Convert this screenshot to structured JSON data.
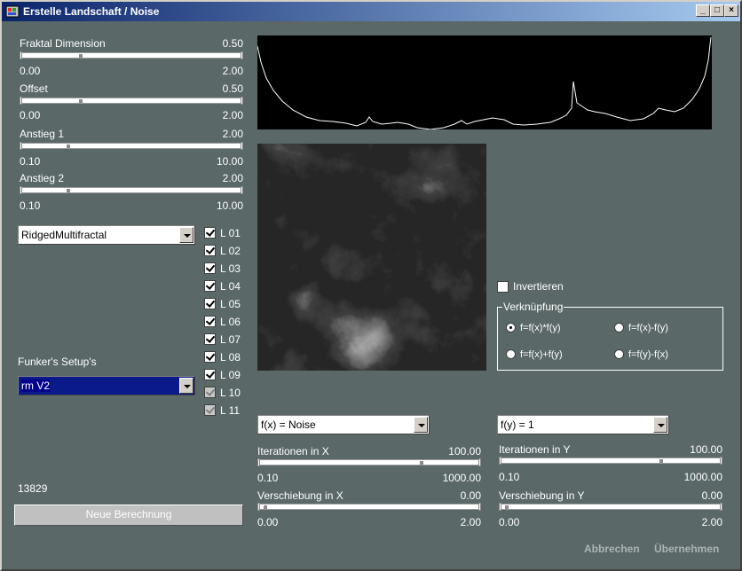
{
  "window": {
    "title": "Erstelle Landschaft / Noise"
  },
  "title_buttons": {
    "minimize": "_",
    "maximize": "□",
    "close": "×"
  },
  "sliders_left": [
    {
      "label": "Fraktal Dimension",
      "value": "0.50",
      "min": "0.00",
      "max": "2.00"
    },
    {
      "label": "Offset",
      "value": "0.50",
      "min": "0.00",
      "max": "2.00"
    },
    {
      "label": "Anstieg 1",
      "value": "2.00",
      "min": "0.10",
      "max": "10.00"
    },
    {
      "label": "Anstieg 2",
      "value": "2.00",
      "min": "0.10",
      "max": "10.00"
    }
  ],
  "noise_type": {
    "value": "RidgedMultifractal"
  },
  "layers": [
    {
      "label": "L 01",
      "checked": true,
      "enabled": true
    },
    {
      "label": "L 02",
      "checked": true,
      "enabled": true
    },
    {
      "label": "L 03",
      "checked": true,
      "enabled": true
    },
    {
      "label": "L 04",
      "checked": true,
      "enabled": true
    },
    {
      "label": "L 05",
      "checked": true,
      "enabled": true
    },
    {
      "label": "L 06",
      "checked": true,
      "enabled": true
    },
    {
      "label": "L 07",
      "checked": true,
      "enabled": true
    },
    {
      "label": "L 08",
      "checked": true,
      "enabled": true
    },
    {
      "label": "L 09",
      "checked": true,
      "enabled": true
    },
    {
      "label": "L 10",
      "checked": true,
      "enabled": false
    },
    {
      "label": "L 11",
      "checked": true,
      "enabled": false
    }
  ],
  "setup": {
    "label": "Funker's Setup's",
    "value": "rm V2"
  },
  "seed": "13829",
  "recalc_button": "Neue Berechnung",
  "invert": {
    "label": "Invertieren",
    "checked": false
  },
  "combine": {
    "label": "Verknüpfung",
    "options": [
      "f=f(x)*f(y)",
      "f=f(x)-f(y)",
      "f=f(x)+f(y)",
      "f=f(y)-f(x)"
    ],
    "selected": 0
  },
  "fx_select": {
    "value": "f(x) = Noise"
  },
  "fy_select": {
    "value": "f(y) = 1"
  },
  "iter_x": {
    "label": "Iterationen in X",
    "value": "100.00",
    "min": "0.10",
    "max": "1000.00"
  },
  "shift_x": {
    "label": "Verschiebung in X",
    "value": "0.00",
    "min": "0.00",
    "max": "2.00"
  },
  "iter_y": {
    "label": "Iterationen in Y",
    "value": "100.00",
    "min": "0.10",
    "max": "1000.00"
  },
  "shift_y": {
    "label": "Verschiebung in Y",
    "value": "0.00",
    "min": "0.00",
    "max": "2.00"
  },
  "footer": {
    "cancel": "Abbrechen",
    "apply": "Übernehmen"
  }
}
